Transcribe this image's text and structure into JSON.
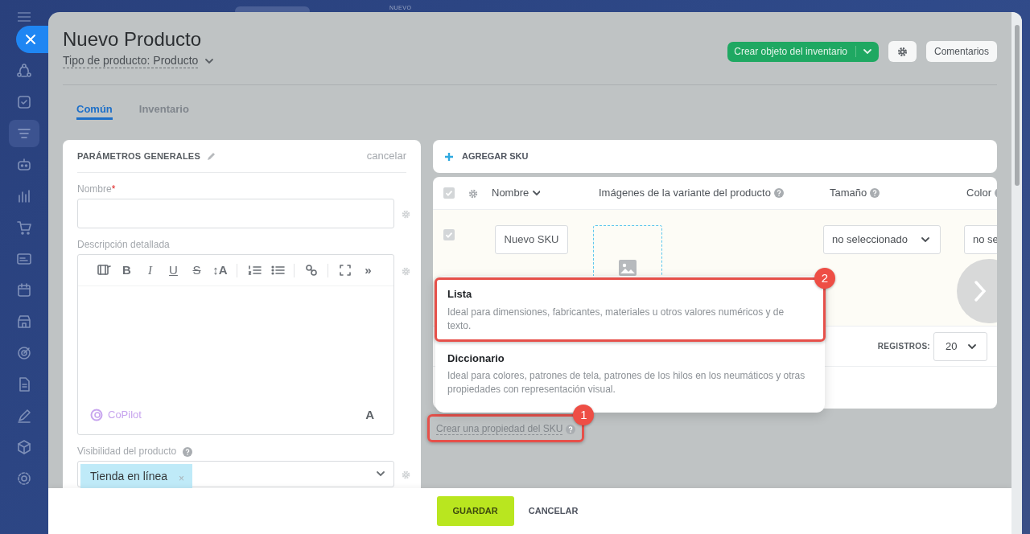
{
  "background": {
    "label": "NUEVO"
  },
  "sidebar": {
    "items": [
      {
        "kind": "network",
        "selected": false
      },
      {
        "kind": "tasks",
        "selected": false
      },
      {
        "kind": "funnel",
        "selected": true
      },
      {
        "kind": "robot",
        "selected": false
      },
      {
        "kind": "chart",
        "selected": false
      },
      {
        "kind": "cart",
        "selected": false
      },
      {
        "kind": "card",
        "selected": false
      },
      {
        "kind": "calendar",
        "selected": false
      },
      {
        "kind": "store",
        "selected": false
      },
      {
        "kind": "target",
        "selected": false
      },
      {
        "kind": "doc",
        "selected": false
      },
      {
        "kind": "pen",
        "selected": false
      },
      {
        "kind": "cube",
        "selected": false
      },
      {
        "kind": "gear",
        "selected": false
      }
    ]
  },
  "header": {
    "title": "Nuevo Producto",
    "type_selector": "Tipo de producto: Producto",
    "primary_button": "Crear objeto del inventario",
    "comments_button": "Comentarios"
  },
  "tabs": [
    {
      "label": "Común",
      "selected": true
    },
    {
      "label": "Inventario",
      "selected": false
    }
  ],
  "general_card": {
    "title": "PARÁMETROS GENERALES",
    "cancel": "cancelar",
    "fields": [
      {
        "kind": "text",
        "label": "Nombre",
        "required": "*"
      },
      {
        "kind": "editor",
        "label": "Descripción detallada",
        "copilot": "CoPilot",
        "font_button": "A",
        "toolbar": [
          {
            "kind": "video"
          },
          {
            "kind": "bold",
            "text": "B"
          },
          {
            "kind": "italic",
            "text": "I"
          },
          {
            "kind": "underline",
            "text": "U"
          },
          {
            "kind": "strike",
            "text": "S"
          },
          {
            "kind": "glyph",
            "text": "↕A"
          },
          {
            "kind": "divider"
          },
          {
            "kind": "ordered-list"
          },
          {
            "kind": "bullet-list"
          },
          {
            "kind": "divider"
          },
          {
            "kind": "link"
          },
          {
            "kind": "divider"
          },
          {
            "kind": "fullscreen"
          },
          {
            "kind": "glyph",
            "text": "»"
          }
        ]
      },
      {
        "kind": "tags",
        "label": "Visibilidad del producto",
        "tags": [
          {
            "text": "Tienda en línea",
            "remove": "×"
          }
        ]
      }
    ]
  },
  "sku": {
    "add_label": "AGREGAR SKU",
    "header_checked": true,
    "columns": [
      {
        "label": "Nombre",
        "kind": "sort"
      },
      {
        "label": "Imágenes de la variante del producto",
        "kind": "help"
      },
      {
        "label": "Tamaño",
        "kind": "help"
      },
      {
        "label": "Color",
        "kind": "help"
      }
    ],
    "rows": [
      {
        "checked": true,
        "name": "Nuevo SKU",
        "size": "no seleccionado",
        "color_value": "no se"
      }
    ],
    "page_size_label": "REGISTROS:",
    "page_size": "20",
    "create_property": {
      "text": "Crear una propiedad del SKU",
      "callout": "1"
    }
  },
  "menu": {
    "items": [
      {
        "title": "Lista",
        "description": "Ideal para dimensiones, fabricantes, materiales u otros valores numéricos y de texto.",
        "callout": "2"
      },
      {
        "title": "Diccionario",
        "description": "Ideal para colores, patrones de tela, patrones de los hilos en los neumáticos y otras propiedades con representación visual."
      }
    ]
  },
  "footer": {
    "save": "GUARDAR",
    "cancel": "CANCELAR"
  }
}
